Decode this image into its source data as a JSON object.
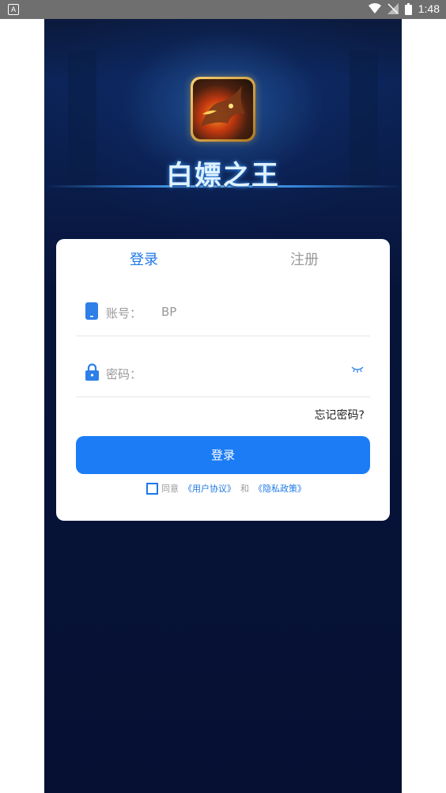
{
  "status_bar": {
    "left_icon_letter": "A",
    "time": "1:48"
  },
  "app": {
    "title": "白嫖之王",
    "icon": "dragon-app-icon"
  },
  "tabs": {
    "login": "登录",
    "register": "注册"
  },
  "fields": {
    "account": {
      "label": "账号：",
      "value": "BP",
      "icon": "phone-icon"
    },
    "password": {
      "label": "密码：",
      "value": "",
      "icon": "lock-icon",
      "toggle_icon": "eye-closed-icon"
    }
  },
  "forgot_password": "忘记密码?",
  "login_button": "登录",
  "agreement": {
    "prefix": "同意",
    "user_agreement": "《用户协议》",
    "and": "和",
    "privacy_policy": "《隐私政策》"
  },
  "colors": {
    "accent": "#1c7cf6",
    "background_dark": "#061033"
  }
}
